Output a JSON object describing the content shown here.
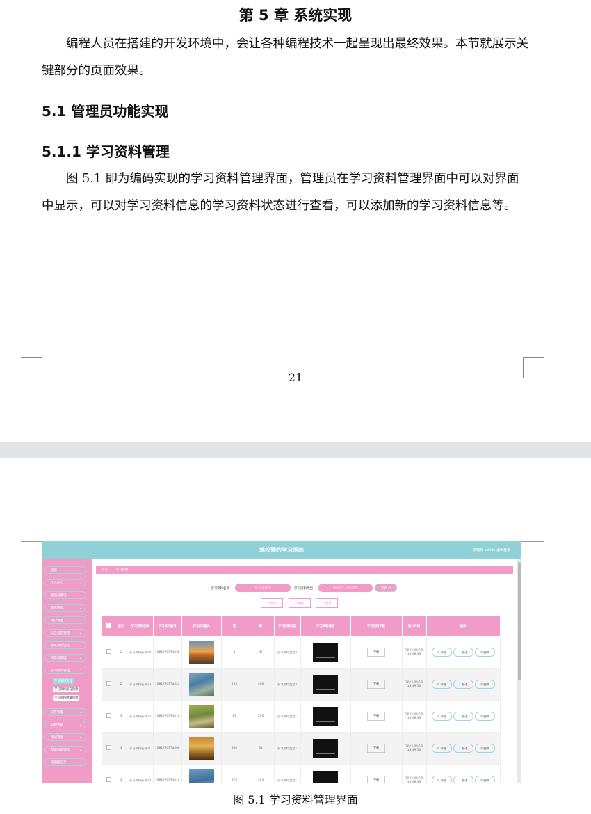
{
  "page1": {
    "chapter_title": "第 5 章  系统实现",
    "intro": "编程人员在搭建的开发环境中，会让各种编程技术一起呈现出最终效果。本节就展示关键部分的页面效果。",
    "section_title": "5.1  管理员功能实现",
    "subsection_title": "5.1.1  学习资料管理",
    "body": "图 5.1 即为编码实现的学习资料管理界面，管理员在学习资料管理界面中可以对界面中显示，可以对学习资料信息的学习资料状态进行查看，可以添加新的学习资料信息等。",
    "page_number": "21"
  },
  "screenshot": {
    "app_title": "驾校预约学习系统",
    "user_info": "管理员 admin    退出登录",
    "sidebar": [
      {
        "label": "首页",
        "arrow": ""
      },
      {
        "label": "个人中心",
        "arrow": "⌄"
      },
      {
        "label": "管理员管理",
        "arrow": "⌄"
      },
      {
        "label": "教练管理",
        "arrow": "⌄"
      },
      {
        "label": "用户管理",
        "arrow": "⌄"
      },
      {
        "label": "公告信息管理",
        "arrow": "⌄"
      },
      {
        "label": "教练预约管理",
        "arrow": "⌄"
      },
      {
        "label": "驾车场管理",
        "arrow": "⌄"
      },
      {
        "label": "学习资料管理",
        "arrow": "⌃"
      },
      {
        "label": "试卷管理",
        "arrow": "⌄"
      },
      {
        "label": "试题管理",
        "arrow": "⌄"
      },
      {
        "label": "考试管理",
        "arrow": "⌄"
      },
      {
        "label": "基础数据管理",
        "arrow": "⌄"
      },
      {
        "label": "轮播图信息",
        "arrow": "⌄"
      }
    ],
    "sidebar_sub": [
      "学习资料管理",
      "学习资料留言管理",
      "学习资料收藏管理"
    ],
    "breadcrumb": [
      "首页",
      "学习资料"
    ],
    "search": {
      "name_label": "学习资料名称",
      "name_placeholder": "学习资料名称",
      "type_label": "学习资料类型",
      "type_placeholder": "请选择学习资料类型",
      "query_button": "查询 ○"
    },
    "actions": [
      "+ 新增",
      "⊟ 删除",
      "◷ 报表"
    ],
    "table": {
      "headers": [
        "",
        "索引",
        "学习资料名称",
        "学习资料编号",
        "学习资料图片",
        "赞",
        "踩",
        "学习资料类型",
        "学习资料视频",
        "学习资料下载",
        "录入时间",
        "操作"
      ],
      "download_label": "下载",
      "op_labels": [
        "⊡ 详情",
        "∠ 修改",
        "⊡ 删除"
      ],
      "rows": [
        {
          "idx": "1",
          "name": "学习资料名称14",
          "code": "1681796974058",
          "like": "6",
          "dislike": "47",
          "type": "学习资料类型2",
          "time": "2023-04-18 13:49:33"
        },
        {
          "idx": "2",
          "name": "学习资料名称13",
          "code": "1681796974024",
          "like": "493",
          "dislike": "408",
          "type": "学习资料类型2",
          "time": "2023-04-18 13:49:33"
        },
        {
          "idx": "3",
          "name": "学习资料名称12",
          "code": "1681796974010",
          "like": "93",
          "dislike": "296",
          "type": "学习资料类型1",
          "time": "2023-04-18 13:49:33"
        },
        {
          "idx": "4",
          "name": "学习资料名称11",
          "code": "1681796974066",
          "like": "346",
          "dislike": "34",
          "type": "学习资料类型1",
          "time": "2023-04-18 13:49:33"
        },
        {
          "idx": "5",
          "name": "学习资料名称10",
          "code": "1681796974010",
          "like": "475",
          "dislike": "314",
          "type": "学习资料类型1",
          "time": "2023-04-18 13:49:33"
        }
      ]
    }
  },
  "caption": "图 5.1  学习资料管理界面",
  "colors": {
    "pink": "#f09cc6",
    "teal": "#8fd1d6",
    "gap": "#e2e3e6"
  }
}
